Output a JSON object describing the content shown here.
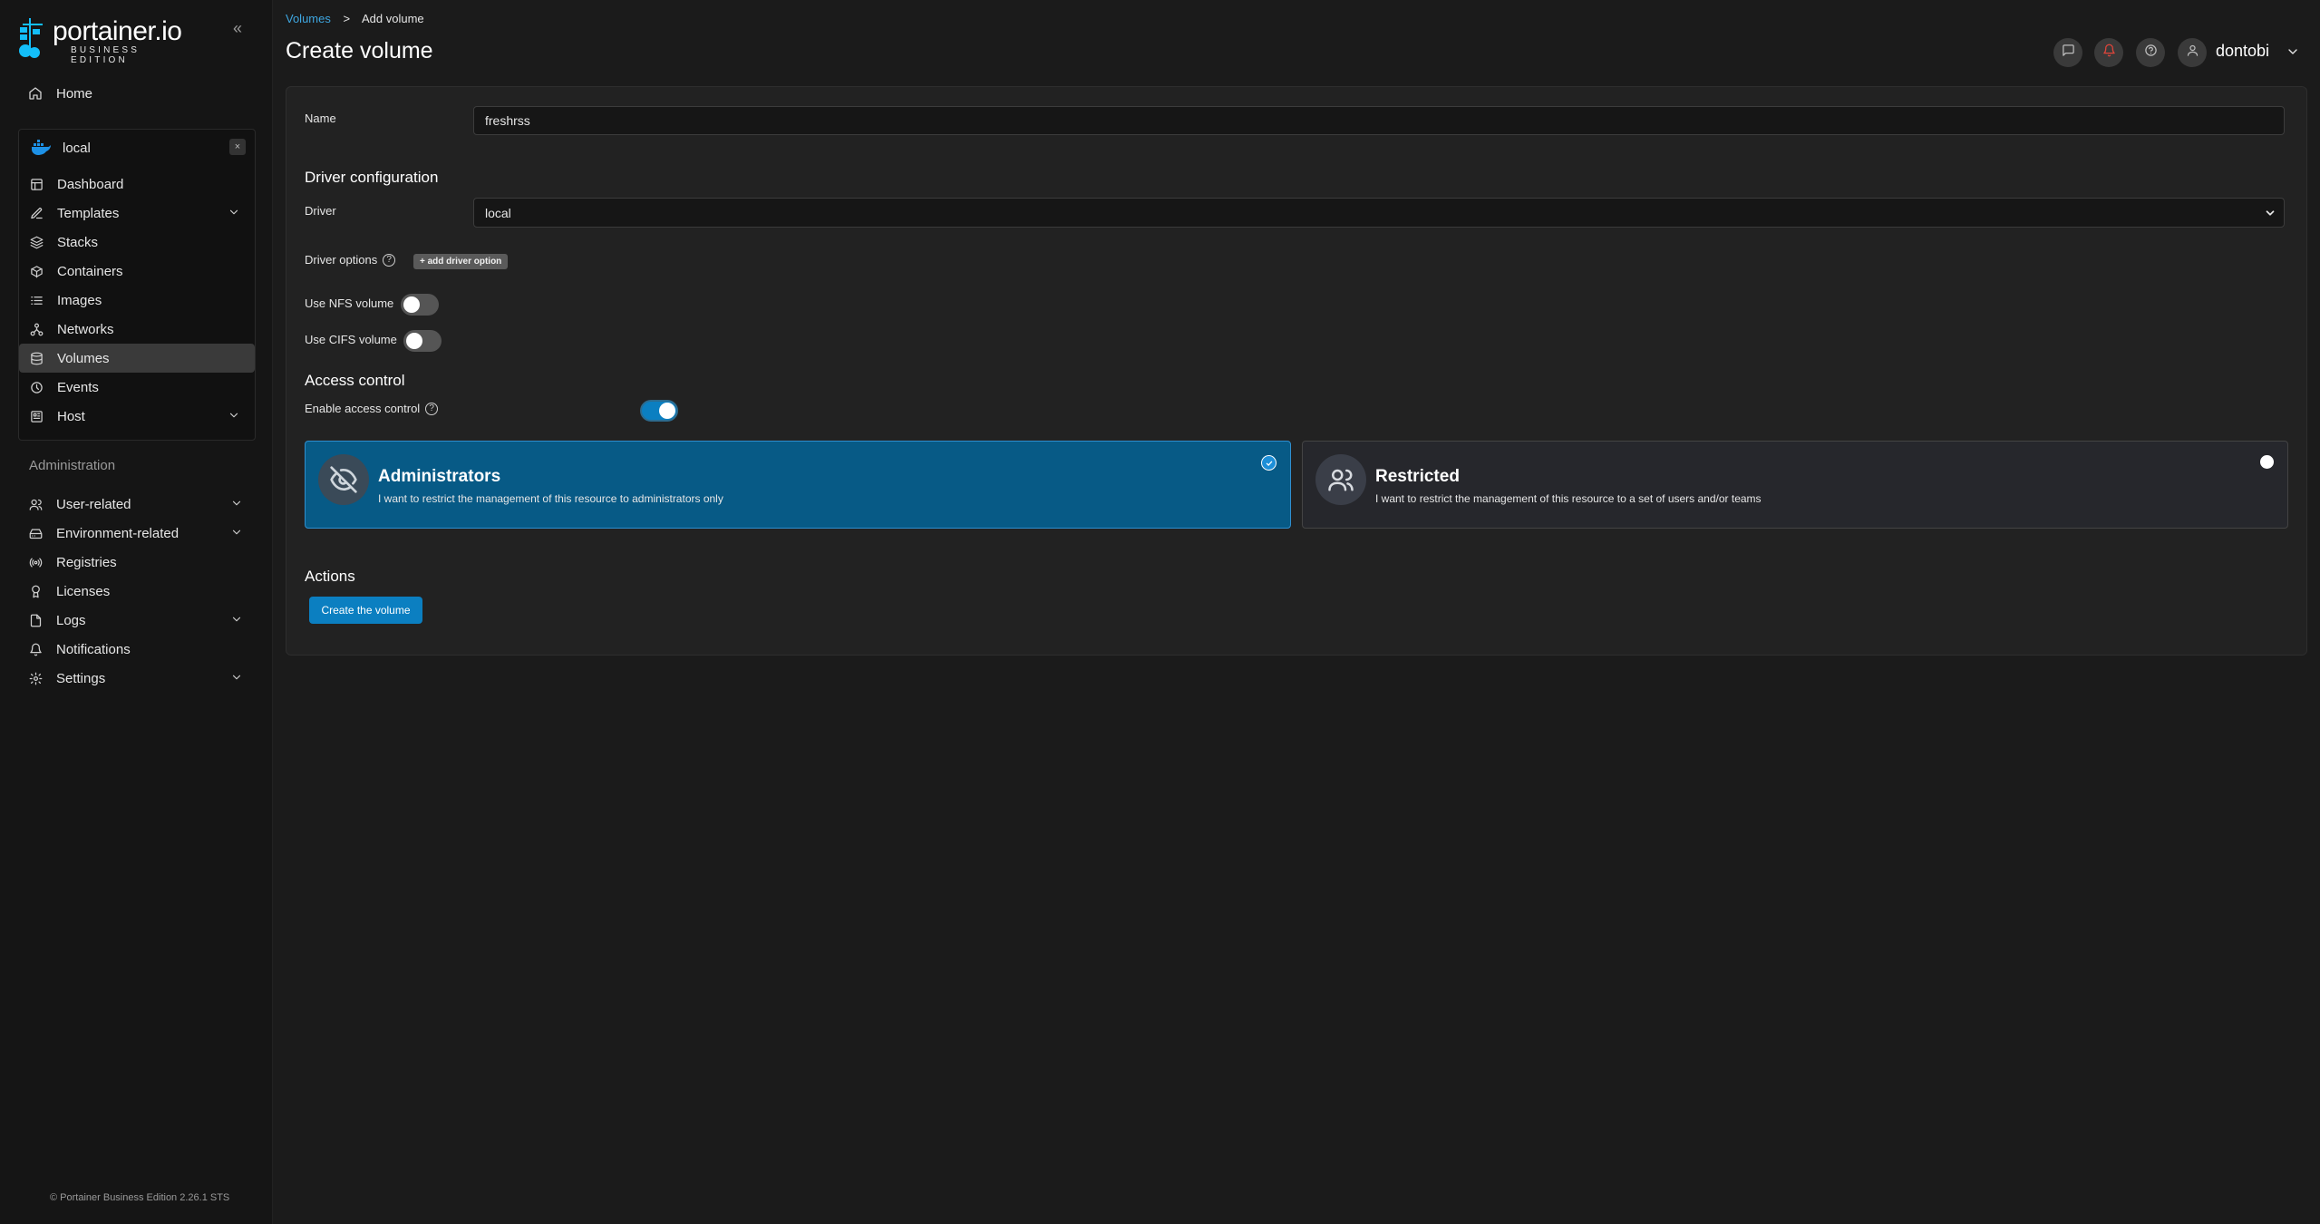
{
  "brand": {
    "name": "portainer.io",
    "edition": "BUSINESS EDITION",
    "footer": "© Portainer Business Edition 2.26.1 STS"
  },
  "sidebar": {
    "home": "Home",
    "environment": {
      "name": "local",
      "close": "×",
      "items": [
        {
          "label": "Dashboard",
          "icon": "dashboard-icon"
        },
        {
          "label": "Templates",
          "icon": "edit-icon",
          "expandable": true
        },
        {
          "label": "Stacks",
          "icon": "layers-icon"
        },
        {
          "label": "Containers",
          "icon": "box-icon"
        },
        {
          "label": "Images",
          "icon": "list-icon"
        },
        {
          "label": "Networks",
          "icon": "network-icon"
        },
        {
          "label": "Volumes",
          "icon": "database-icon",
          "active": true
        },
        {
          "label": "Events",
          "icon": "clock-icon"
        },
        {
          "label": "Host",
          "icon": "host-icon",
          "expandable": true
        }
      ]
    },
    "administration": {
      "header": "Administration",
      "items": [
        {
          "label": "User-related",
          "icon": "users-icon",
          "expandable": true
        },
        {
          "label": "Environment-related",
          "icon": "server-icon",
          "expandable": true
        },
        {
          "label": "Registries",
          "icon": "radio-icon"
        },
        {
          "label": "Licenses",
          "icon": "award-icon"
        },
        {
          "label": "Logs",
          "icon": "file-icon",
          "expandable": true
        },
        {
          "label": "Notifications",
          "icon": "bell-icon"
        },
        {
          "label": "Settings",
          "icon": "gear-icon",
          "expandable": true
        }
      ]
    }
  },
  "header": {
    "breadcrumb": {
      "parent": "Volumes",
      "separator": ">",
      "current": "Add volume"
    },
    "title": "Create volume",
    "username": "dontobi"
  },
  "form": {
    "name_label": "Name",
    "name_value": "freshrss",
    "driver_section": "Driver configuration",
    "driver_label": "Driver",
    "driver_value": "local",
    "driver_options_label": "Driver options",
    "add_driver_option": "+ add driver option",
    "nfs_label": "Use NFS volume",
    "nfs_enabled": false,
    "cifs_label": "Use CIFS volume",
    "cifs_enabled": false,
    "access_section": "Access control",
    "enable_access_label": "Enable access control",
    "access_enabled": true,
    "options": [
      {
        "title": "Administrators",
        "description": "I want to restrict the management of this resource to administrators only",
        "selected": true
      },
      {
        "title": "Restricted",
        "description": "I want to restrict the management of this resource to a set of users and/or teams",
        "selected": false
      }
    ],
    "actions_section": "Actions",
    "submit_label": "Create the volume"
  },
  "colors": {
    "accent": "#0b7fc1",
    "link": "#3ea6e0",
    "background": "#1b1b1b",
    "sidebar": "#151515"
  }
}
